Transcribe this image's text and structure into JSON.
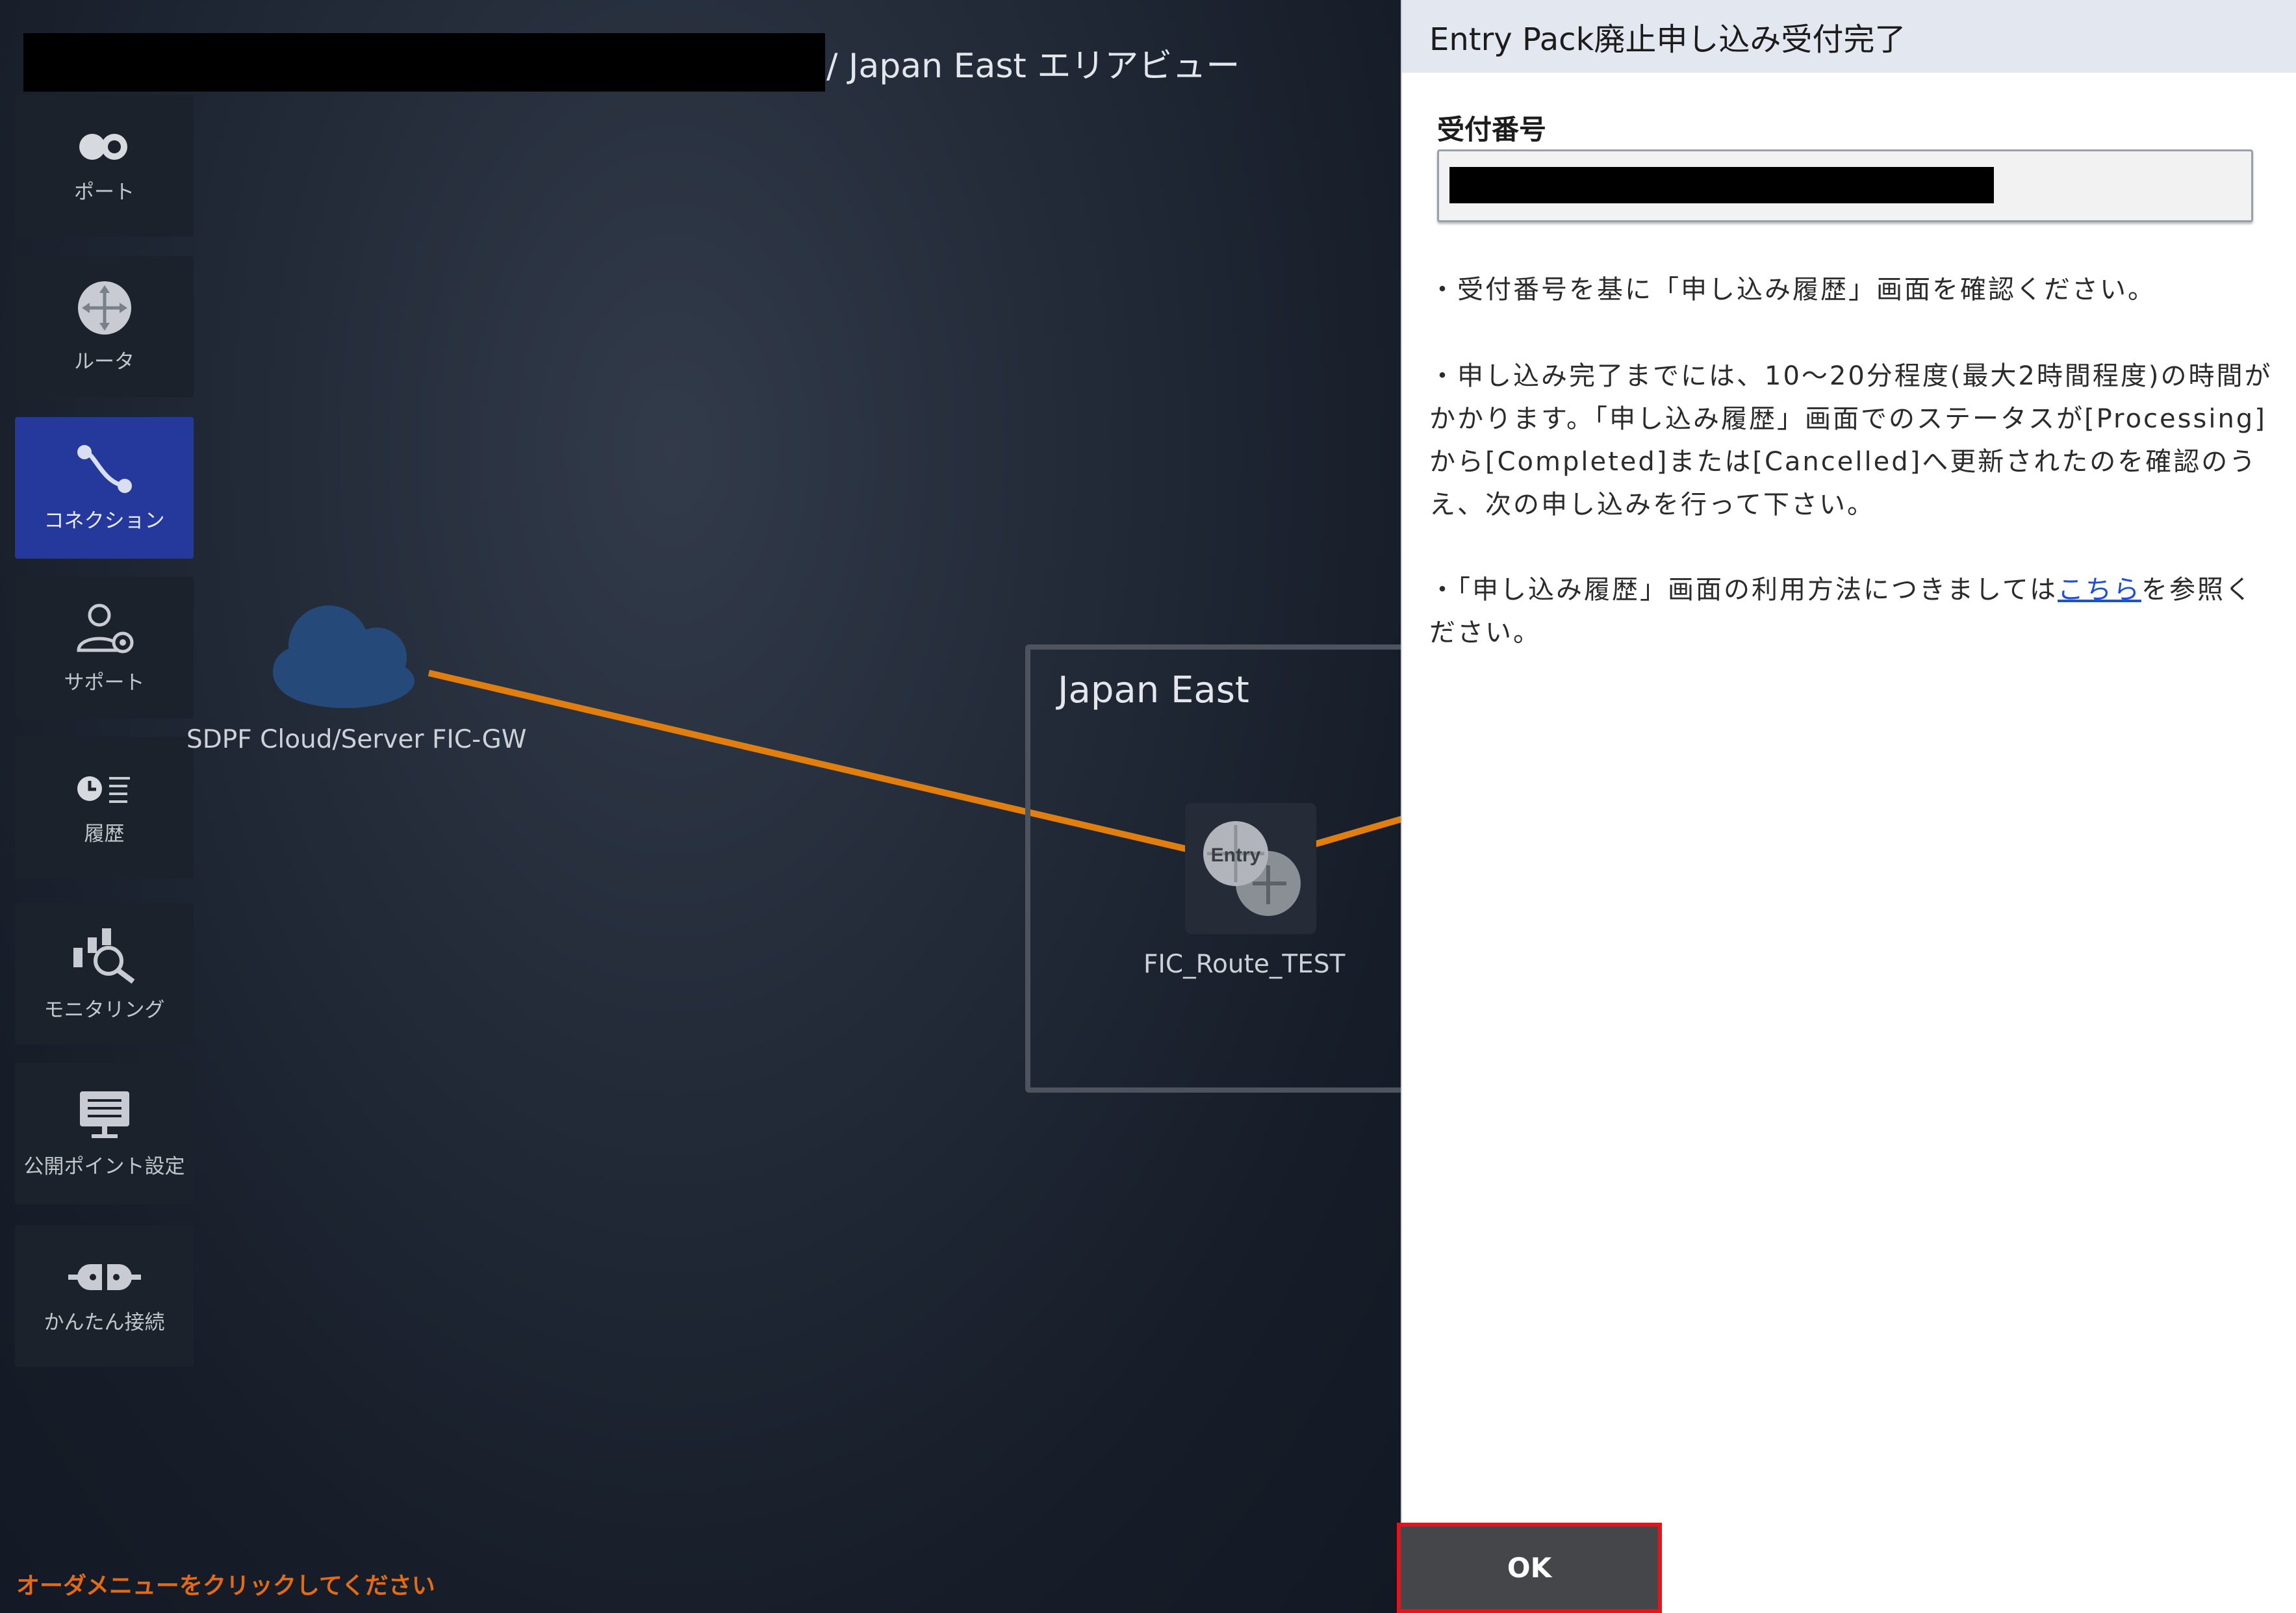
{
  "header": {
    "title_suffix": "/ Japan East エリアビュー"
  },
  "sidebar": {
    "items": [
      {
        "label": "ポート",
        "icon": "port-icon"
      },
      {
        "label": "ルータ",
        "icon": "router-icon"
      },
      {
        "label": "コネクション",
        "icon": "connection-icon",
        "active": true
      },
      {
        "label": "サポート",
        "icon": "support-icon"
      },
      {
        "label": "履歴",
        "icon": "history-icon"
      },
      {
        "label": "モニタリング",
        "icon": "monitoring-icon"
      },
      {
        "label": "公開ポイント設定",
        "icon": "public-point-icon"
      },
      {
        "label": "かんたん接続",
        "icon": "easy-connect-icon"
      }
    ]
  },
  "diagram": {
    "cloud_label": "SDPF Cloud/Server FIC-GW",
    "region_label": "Japan East",
    "router_badge": "Entry",
    "router_label": "FIC_Route_TEST",
    "connection_color": "#e07f10"
  },
  "footer": {
    "note": "オーダメニューをクリックしてください"
  },
  "dialog": {
    "title": "Entry Pack廃止申し込み受付完了",
    "field_label": "受付番号",
    "note1": "・受付番号を基に「申し込み履歴」画面を確認ください。",
    "note2": "・申し込み完了までには、10～20分程度(最大2時間程度)の時間がかかります。「申し込み履歴」画面でのステータスが[Processing]から[Completed]または[Cancelled]へ更新されたのを確認のうえ、次の申し込みを行って下さい。",
    "note3_before": "・「申し込み履歴」画面の利用方法につきましては",
    "note3_link": "こちら",
    "note3_after": "を参照ください。",
    "ok_label": "OK"
  },
  "colors": {
    "sidebar_active": "#24399b",
    "ok_highlight": "#e8131a",
    "footer_note": "#e56a14",
    "link": "#1d4fd8"
  }
}
